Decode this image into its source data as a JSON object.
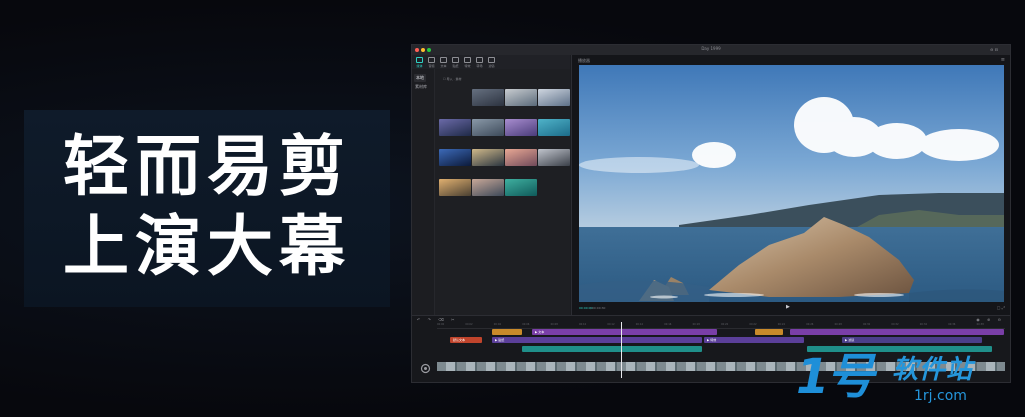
{
  "promo": {
    "line1": "轻而易剪",
    "line2": "上演大幕"
  },
  "window": {
    "title": "Day 1999",
    "controls": "⊖ ⊟",
    "accent": "#2fd1c4"
  },
  "toolbar": {
    "items": [
      {
        "label": "媒体",
        "icon": "media-icon"
      },
      {
        "label": "音频",
        "icon": "audio-icon"
      },
      {
        "label": "文本",
        "icon": "text-icon"
      },
      {
        "label": "贴纸",
        "icon": "sticker-icon"
      },
      {
        "label": "特效",
        "icon": "effects-icon"
      },
      {
        "label": "转场",
        "icon": "transition-icon"
      },
      {
        "label": "滤镜",
        "icon": "filter-icon"
      }
    ]
  },
  "categories": {
    "items": [
      "本地",
      "素材库"
    ]
  },
  "media_panel": {
    "tab_label": "☐ 导入 · 素材",
    "thumbs": [
      {
        "caption": "",
        "color1": "#2c3340",
        "color2": "#667080"
      },
      {
        "caption": "",
        "color1": "#5a6a7a",
        "color2": "#c8ccd0"
      },
      {
        "caption": "",
        "color1": "#5d7088",
        "color2": "#cfd6e0"
      },
      {
        "caption": "",
        "color1": "#1f2a48",
        "color2": "#6b6aa8"
      },
      {
        "caption": "",
        "color1": "#3d4a5a",
        "color2": "#8a99a8"
      },
      {
        "caption": "",
        "color1": "#4a3c7a",
        "color2": "#a88dcf"
      },
      {
        "caption": "",
        "color1": "#1c6c8a",
        "color2": "#4fb3c9"
      },
      {
        "caption": "",
        "color1": "#0c1a3a",
        "color2": "#3c6ab8"
      },
      {
        "caption": "",
        "color1": "#2b3540",
        "color2": "#cfb88a"
      },
      {
        "caption": "",
        "color1": "#704a5a",
        "color2": "#e8a894"
      },
      {
        "caption": "",
        "color1": "#3a3f48",
        "color2": "#c0c4cc"
      },
      {
        "caption": "",
        "color1": "#4a4032",
        "color2": "#e0b070"
      },
      {
        "caption": "",
        "color1": "#3c4858",
        "color2": "#c8a898"
      },
      {
        "caption": "",
        "color1": "#0f5a5a",
        "color2": "#3fb0a0"
      }
    ]
  },
  "preview": {
    "header": "播放器",
    "menu": "≡",
    "footer_time": "00:00:00",
    "footer_total": "/ 00:00:30",
    "play": "▶",
    "footer_right": "▢ ⤢"
  },
  "timeline": {
    "tools_left": "↶ ↷ ⌫ ✂",
    "tools_right": "◉ ⊕ ⊖",
    "ticks": [
      "00:00",
      "00:02",
      "00:04",
      "00:06",
      "00:08",
      "00:10",
      "00:12",
      "00:14",
      "00:16",
      "00:18",
      "00:20",
      "00:22",
      "00:24",
      "00:26",
      "00:28",
      "00:30",
      "00:32",
      "00:34",
      "00:36",
      "00:38"
    ],
    "tracks": [
      {
        "text": "",
        "color": "#c98a2a"
      },
      {
        "text": "▶ 文本",
        "color": "#7a3fa8"
      },
      {
        "text": "",
        "color": "#c98a2a"
      },
      {
        "text": "",
        "color": "#7a3fa8"
      },
      {
        "text": "默认文本",
        "color": "#c0442c"
      },
      {
        "text": "▶ 贴纸",
        "color": "#5b3f9a"
      },
      {
        "text": "▶ 特效",
        "color": "#5b3f9a"
      },
      {
        "text": "▶ 滤镜",
        "color": "#4b3f8a"
      },
      {
        "text": "",
        "color": "#1f8f8a"
      },
      {
        "text": "",
        "color": "#1f8f8a"
      }
    ]
  },
  "watermark": {
    "logo": "1号",
    "name": "软件站",
    "domain": "1rj.com"
  }
}
